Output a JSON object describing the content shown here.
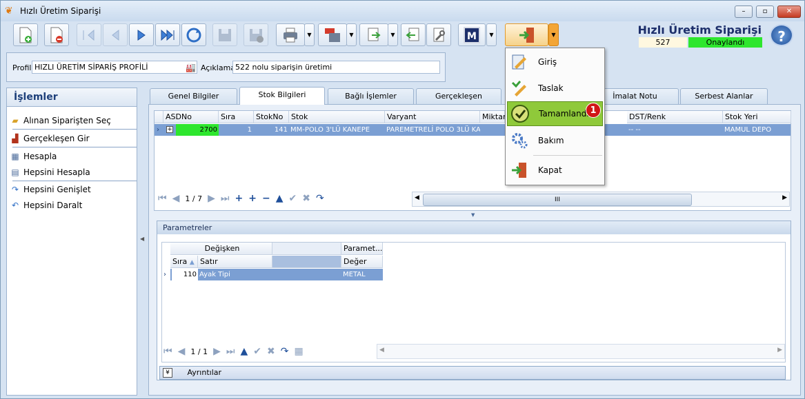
{
  "window": {
    "title": "Hızlı Üretim Siparişi",
    "min": "–",
    "max": "▫",
    "close": "✕"
  },
  "header": {
    "title": "Hızlı Üretim Siparişi",
    "order_no": "527",
    "status": "Onaylandı",
    "status_color": "#2ee62e"
  },
  "toolbar": {
    "m_label": "M",
    "help": "?"
  },
  "profile": {
    "profil_label": "Profil",
    "profil_value": "HIZLI ÜRETİM SİPARİŞ PROFİLİ",
    "aciklama_label": "Açıklama",
    "aciklama_value": "522 nolu siparişin üretimi"
  },
  "left": {
    "title": "İşlemler",
    "items": [
      "Alınan Siparişten Seç",
      "Gerçekleşen Gir",
      "Hesapla",
      "Hepsini Hesapla",
      "Hepsini Genişlet",
      "Hepsini Daralt"
    ]
  },
  "tabs": [
    "Genel Bilgiler",
    "Stok Bilgileri",
    "Bağlı İşlemler",
    "Gerçekleşen",
    "İmalat Notu",
    "Serbest Alanlar"
  ],
  "grid1": {
    "columns": [
      "ASDNo",
      "Sıra",
      "StokNo",
      "Stok",
      "Varyant",
      "Miktar",
      "DST/Renk",
      "Stok Yeri"
    ],
    "row": {
      "asdno": "2700",
      "sira": "1",
      "stokno": "141",
      "stok": "MM-POLO 3'LÜ KANEPE",
      "varyant": "PAREMETRELİ POLO 3LÜ KA",
      "dst": "-- --",
      "stokyeri": "MAMUL DEPO"
    },
    "pager": "1 / 7",
    "scroll_grip": "III"
  },
  "params": {
    "title": "Parametreler",
    "group_header": "Değişken",
    "group_header2": "Paramet...",
    "col_sira": "Sıra",
    "col_etiket": "Satır Etiketi/Değişken",
    "col_deger": "Değer",
    "row": {
      "sira": "110",
      "etiket": "Ayak Tipi",
      "deger": "METAL"
    },
    "pager": "1 / 1"
  },
  "details": {
    "label": "Ayrıntılar",
    "toggle": "¥"
  },
  "menu": {
    "items": [
      "Giriş",
      "Taslak",
      "Tamamlandı",
      "Bakım",
      "Kapat"
    ],
    "highlight": "Tamamlandı",
    "badge": "1"
  }
}
